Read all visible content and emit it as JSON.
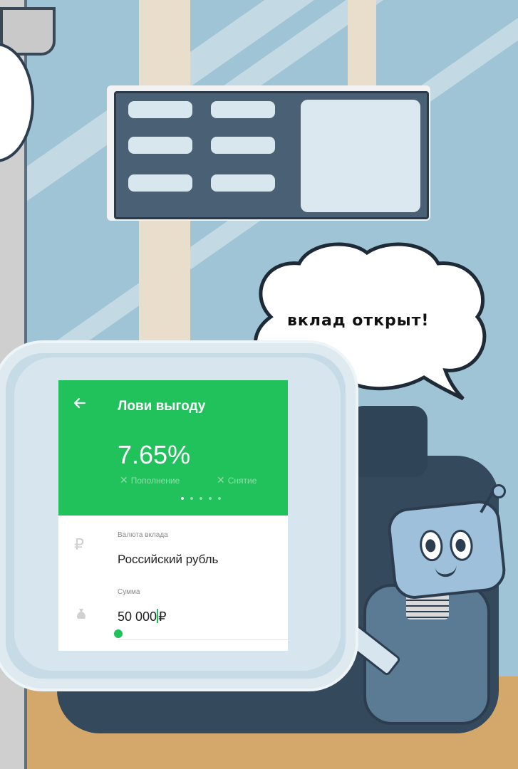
{
  "speech": {
    "text": "вклад открыт!"
  },
  "app": {
    "header": {
      "back_icon": "arrow-left-icon",
      "title": "Лови выгоду",
      "rate": "7.65%",
      "flags": [
        {
          "mark": "✕",
          "label": "Пополнение"
        },
        {
          "mark": "✕",
          "label": "Снятие"
        }
      ],
      "pager": {
        "count": 5,
        "active_index": 0
      }
    },
    "currency_field": {
      "icon": "ruble-icon",
      "label": "Валюта вклада",
      "value": "Российский рубль"
    },
    "amount_field": {
      "icon": "money-bag-icon",
      "label": "Сумма",
      "value": "50 000",
      "currency_symbol": "₽"
    },
    "colors": {
      "accent": "#21c15b",
      "text": "#222222",
      "label": "#8a8a8a"
    }
  }
}
